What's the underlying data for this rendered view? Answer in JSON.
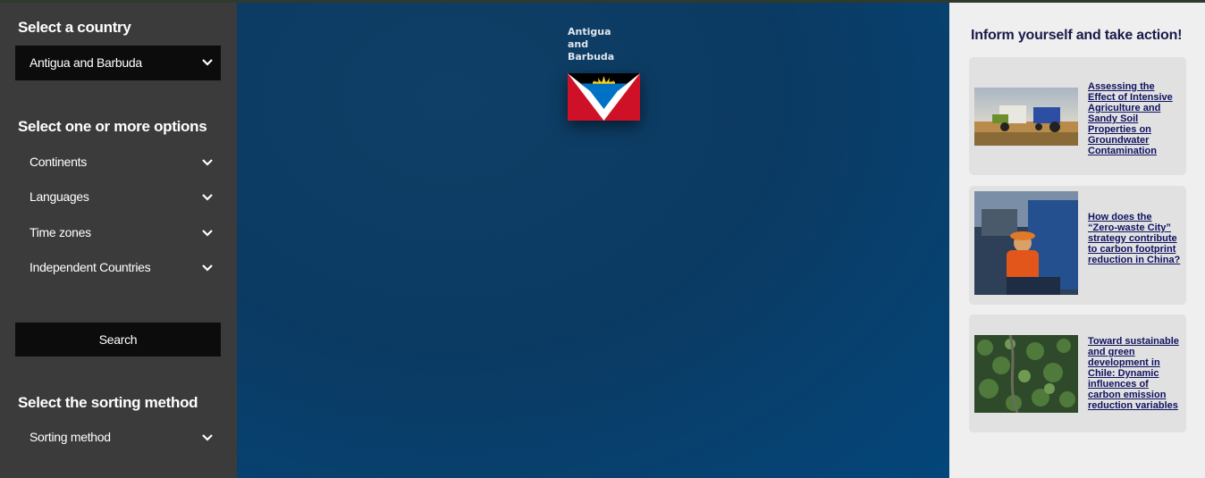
{
  "sidebar": {
    "country_title": "Select a country",
    "country_value": "Antigua and Barbuda",
    "options_title": "Select one or more options",
    "options": [
      {
        "label": "Continents"
      },
      {
        "label": "Languages"
      },
      {
        "label": "Time zones"
      },
      {
        "label": "Independent Countries"
      }
    ],
    "search_label": "Search",
    "sorting_title": "Select the sorting method",
    "sorting_label": "Sorting method"
  },
  "main": {
    "country_name": "Antigua and Barbuda",
    "flag_icon": "antigua-and-barbuda-flag"
  },
  "panel": {
    "title": "Inform yourself and take action!",
    "articles": [
      {
        "title": "Assessing the Effect of Intensive Agriculture and Sandy Soil Properties on Groundwater Contamination",
        "image": "harvester-and-tractor"
      },
      {
        "title": "How does the “Zero-waste City” strategy contribute to carbon footprint reduction in China?",
        "image": "waste-worker"
      },
      {
        "title": "Toward sustainable and green development in Chile: Dynamic influences of carbon emission reduction variables",
        "image": "forest-aerial"
      }
    ]
  },
  "colors": {
    "sidebar_bg": "#3b3b3b",
    "control_bg": "#0c0c0c",
    "main_bg": "#0b3a62",
    "panel_bg": "#efefef",
    "card_bg": "#e1e1e1",
    "link": "#0f1260"
  }
}
